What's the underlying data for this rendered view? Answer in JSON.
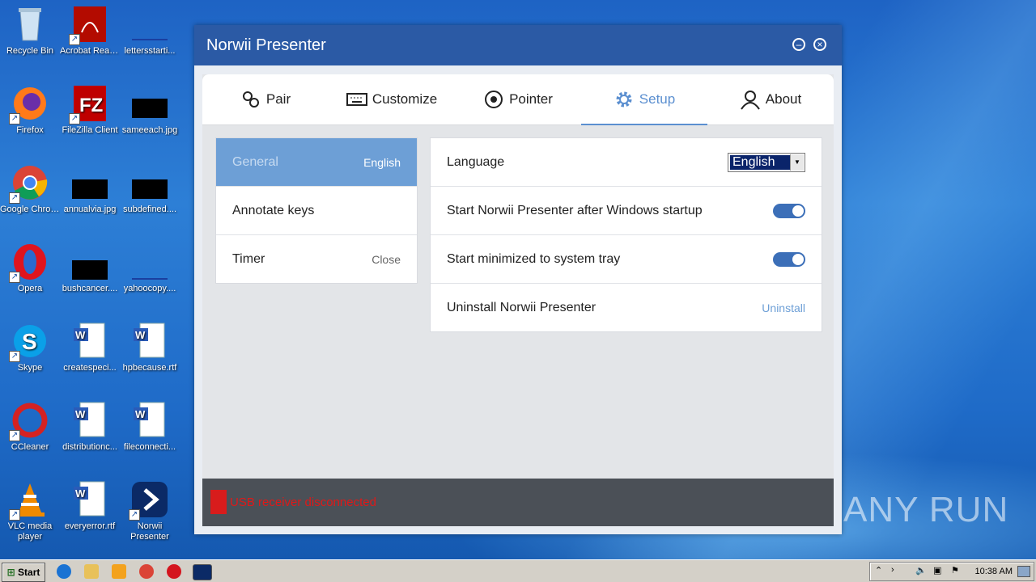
{
  "desktop": {
    "icons": [
      {
        "label": "Recycle Bin"
      },
      {
        "label": "Acrobat Reader DC"
      },
      {
        "label": "lettersstarti..."
      },
      {
        "label": "Firefox"
      },
      {
        "label": "FileZilla Client"
      },
      {
        "label": "sameeach.jpg"
      },
      {
        "label": "Google Chrome"
      },
      {
        "label": "annualvia.jpg"
      },
      {
        "label": "subdefined...."
      },
      {
        "label": "Opera"
      },
      {
        "label": "bushcancer...."
      },
      {
        "label": "yahoocopy...."
      },
      {
        "label": "Skype"
      },
      {
        "label": "createspeci..."
      },
      {
        "label": "hpbecause.rtf"
      },
      {
        "label": "CCleaner"
      },
      {
        "label": "distributionc..."
      },
      {
        "label": "fileconnecti..."
      },
      {
        "label": "VLC media player"
      },
      {
        "label": "everyerror.rtf"
      },
      {
        "label": "Norwii Presenter"
      }
    ]
  },
  "window": {
    "title": "Norwii Presenter",
    "tabs": [
      {
        "label": "Pair",
        "icon": "link-icon"
      },
      {
        "label": "Customize",
        "icon": "keyboard-icon"
      },
      {
        "label": "Pointer",
        "icon": "target-icon"
      },
      {
        "label": "Setup",
        "icon": "gear-icon",
        "active": true
      },
      {
        "label": "About",
        "icon": "person-icon"
      }
    ],
    "sidebar": [
      {
        "label": "General",
        "sub": "English",
        "active": true
      },
      {
        "label": "Annotate keys",
        "sub": ""
      },
      {
        "label": "Timer",
        "sub": "Close"
      }
    ],
    "settings": {
      "language_label": "Language",
      "language_value": "English",
      "startup_label": "Start Norwii Presenter after Windows startup",
      "startup_on": true,
      "minimized_label": "Start minimized to system tray",
      "minimized_on": true,
      "uninstall_label": "Uninstall Norwii Presenter",
      "uninstall_link": "Uninstall"
    },
    "status": "USB receiver disconnected",
    "accent_color": "#2b5aa5",
    "status_color": "#e01818"
  },
  "watermark": "ANY RUN",
  "taskbar": {
    "start_label": "Start",
    "clock": "10:38 AM"
  }
}
